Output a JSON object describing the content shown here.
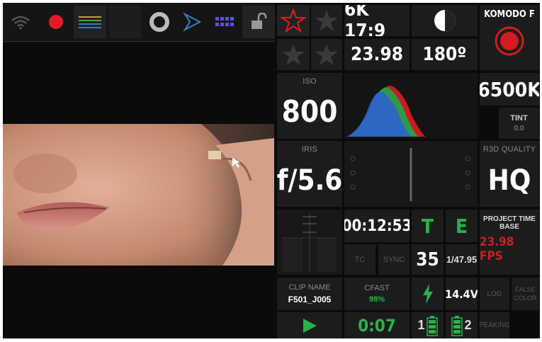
{
  "top_bar": {
    "icons": [
      "wifi-icon",
      "record-dot-icon",
      "waveform-lines-icon",
      "blank-icon",
      "lens-ring-icon",
      "play-outline-icon",
      "grid-icon",
      "unlock-icon"
    ]
  },
  "stars": [
    "favorite-star-active",
    "favorite-star",
    "favorite-star",
    "favorite-star"
  ],
  "format": {
    "resolution": "6K 17:9",
    "fps": "23.98",
    "shutter": "180º"
  },
  "camera": {
    "model": "KOMODO F"
  },
  "iso": {
    "label": "ISO",
    "value": "800"
  },
  "wb": {
    "value": "6500K",
    "tint_label": "TINT",
    "tint_value": "0.0"
  },
  "iris": {
    "label": "IRIS",
    "value": "f/5.6"
  },
  "quality": {
    "label": "R3D QUALITY",
    "value": "HQ"
  },
  "timecode": {
    "value": "00:12:53",
    "t": "T",
    "e": "E",
    "tc": "TC",
    "sync": "SYNC",
    "frames": "35",
    "frame_rate": "1/47.95"
  },
  "project": {
    "label": "PROJECT TIME BASE",
    "value": "23.98 FPS"
  },
  "clip": {
    "label": "CLIP NAME",
    "value": "F501_J005"
  },
  "media": {
    "label": "CFAST",
    "value": "98%"
  },
  "power": {
    "voltage": "14.4V"
  },
  "lut": {
    "log": "LOG",
    "false_color": "FALSE\nCOLOR",
    "peaking": "PEAKING"
  },
  "record": {
    "duration": "0:07"
  },
  "batteries": [
    {
      "slot": "1"
    },
    {
      "slot": "2"
    }
  ],
  "colors": {
    "red": "#d21b22",
    "green": "#28b34a",
    "tile": "#1c1c1c"
  }
}
